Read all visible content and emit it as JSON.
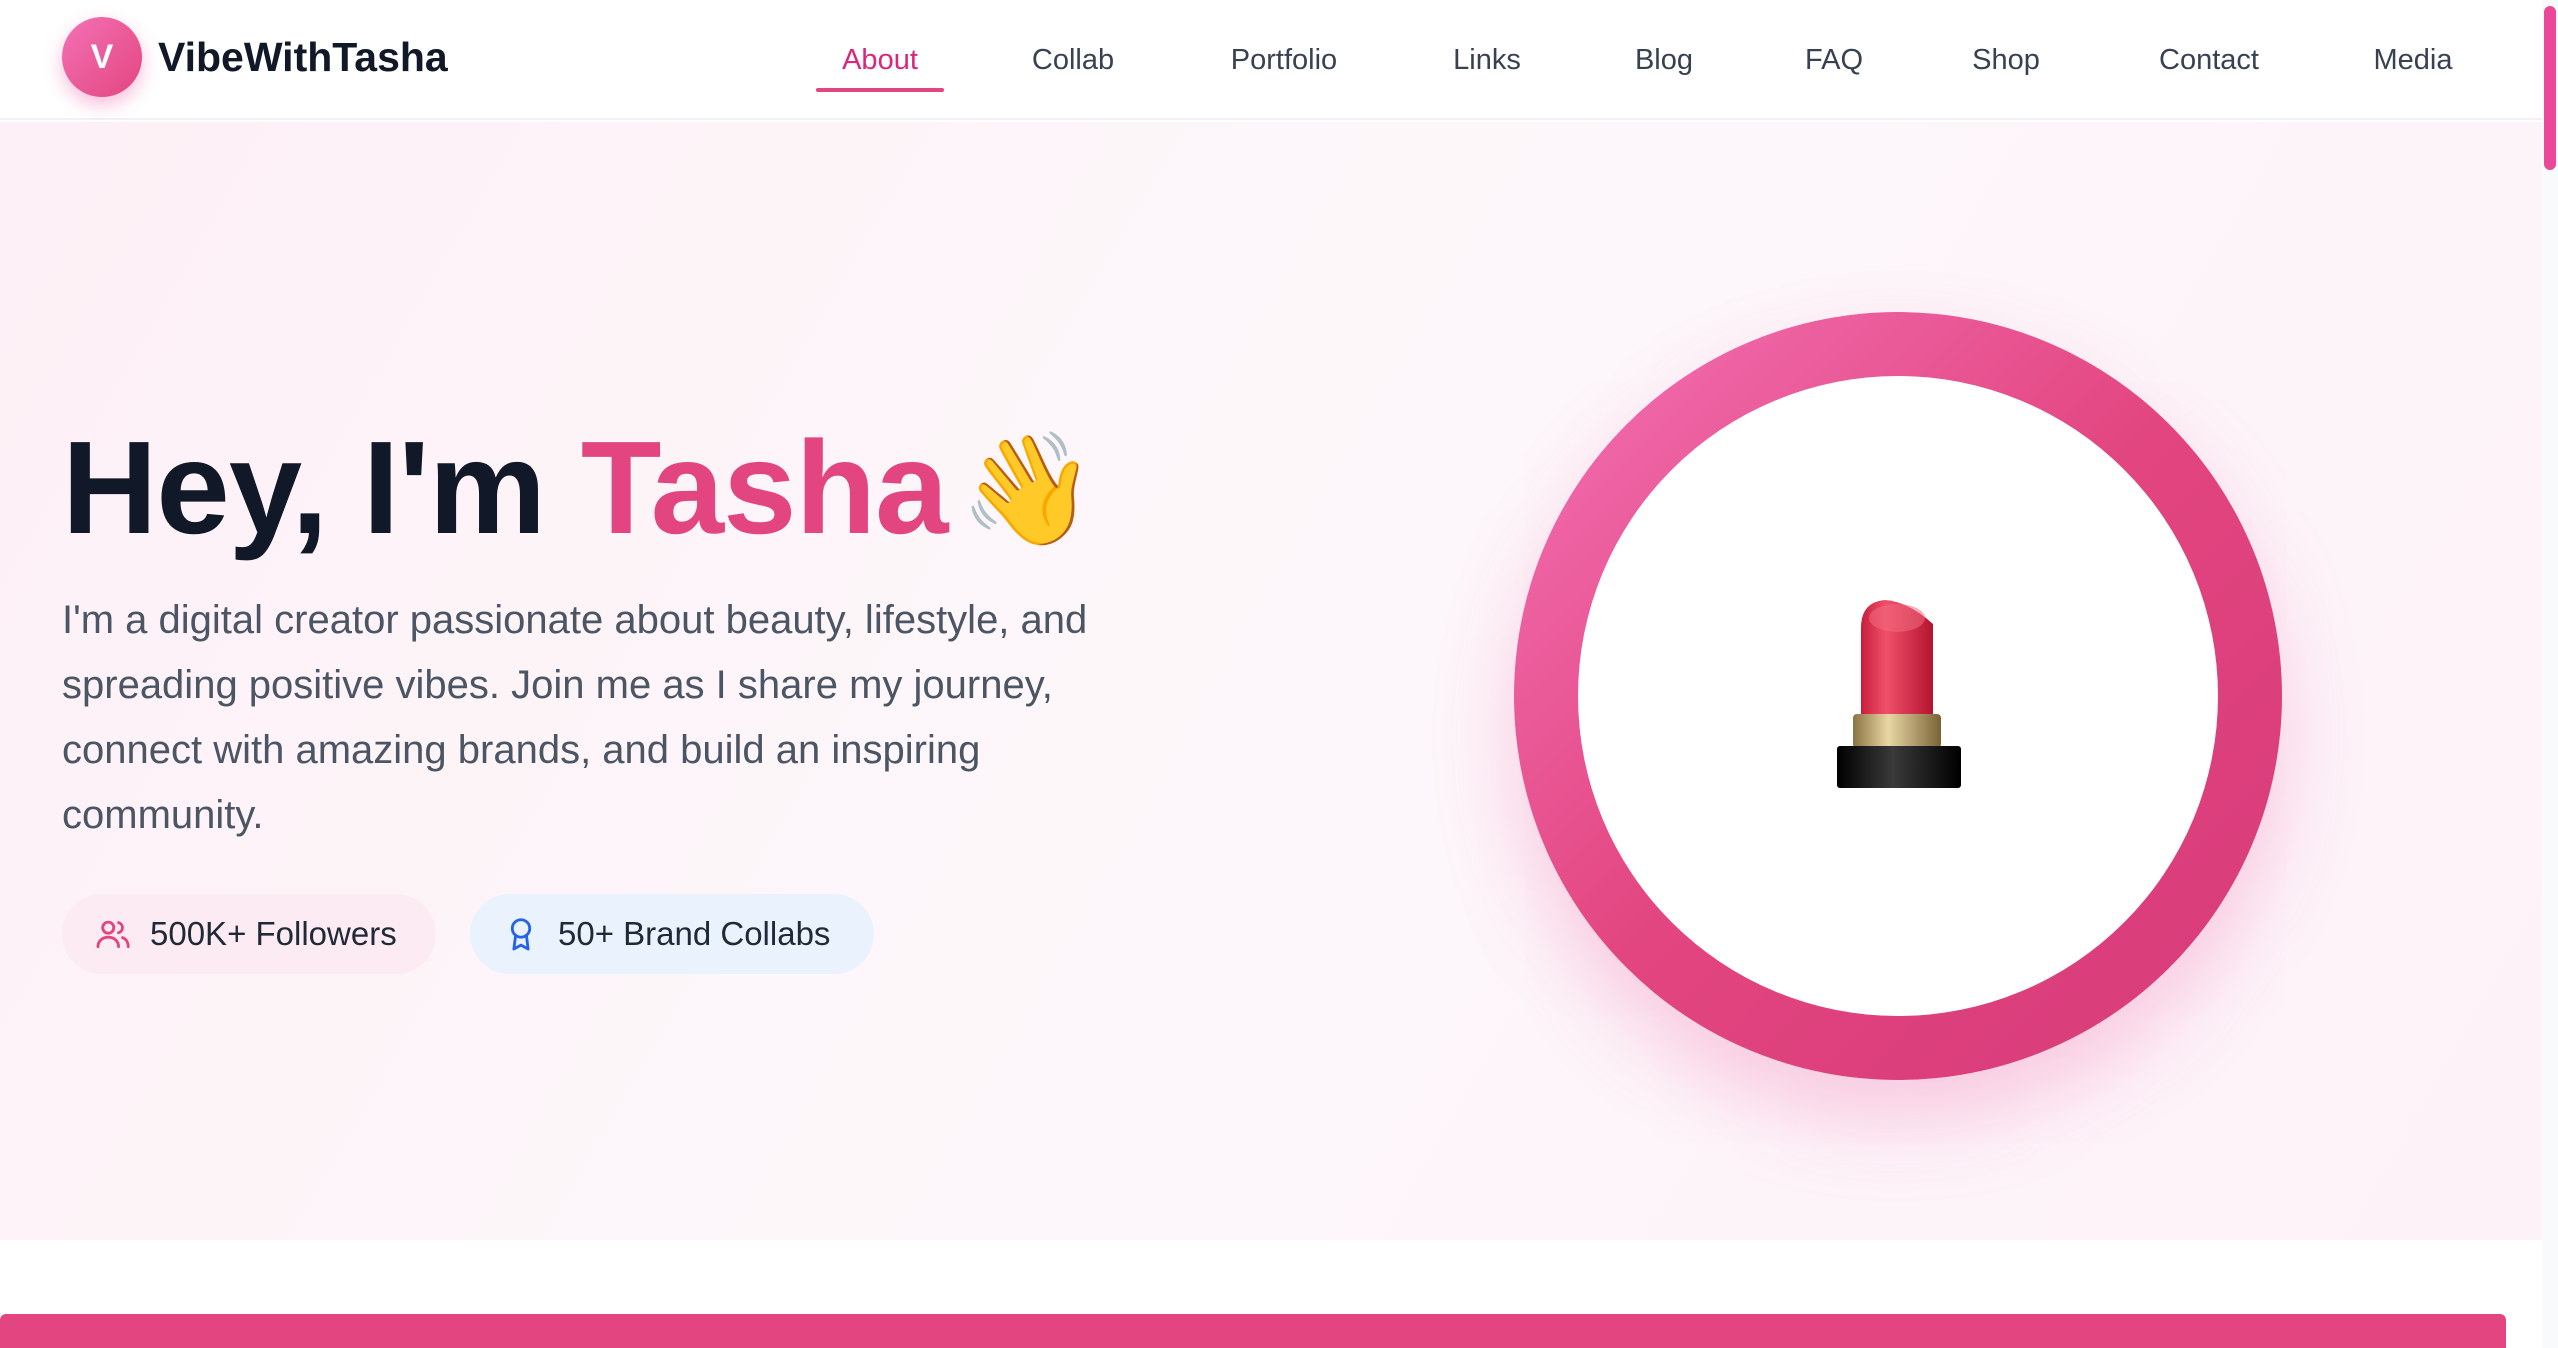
{
  "brand": {
    "logo_letter": "V",
    "name": "VibeWithTasha"
  },
  "nav": {
    "active": "About",
    "items": [
      "About",
      "Collab",
      "Portfolio",
      "Links",
      "Blog",
      "FAQ",
      "Shop",
      "Contact",
      "Media"
    ]
  },
  "hero": {
    "greeting": "Hey, I'm ",
    "name": "Tasha",
    "wave_emoji": "👋",
    "description": "I'm a digital creator passionate about beauty, lifestyle, and spreading positive vibes. Join me as I share my journey, connect with amazing brands, and build an inspiring community.",
    "badges": [
      {
        "icon": "users-icon",
        "label": "500K+ Followers"
      },
      {
        "icon": "award-ribbon-icon",
        "label": "50+ Brand Collabs"
      }
    ],
    "portrait_icon": "lipstick-icon"
  },
  "colors": {
    "accent": "#e2457f",
    "heading": "#111827",
    "body_text": "#4b5563",
    "followers_badge_bg": "#fcebf3",
    "collabs_badge_bg": "#eaf2fd",
    "collabs_icon": "#2563eb"
  }
}
